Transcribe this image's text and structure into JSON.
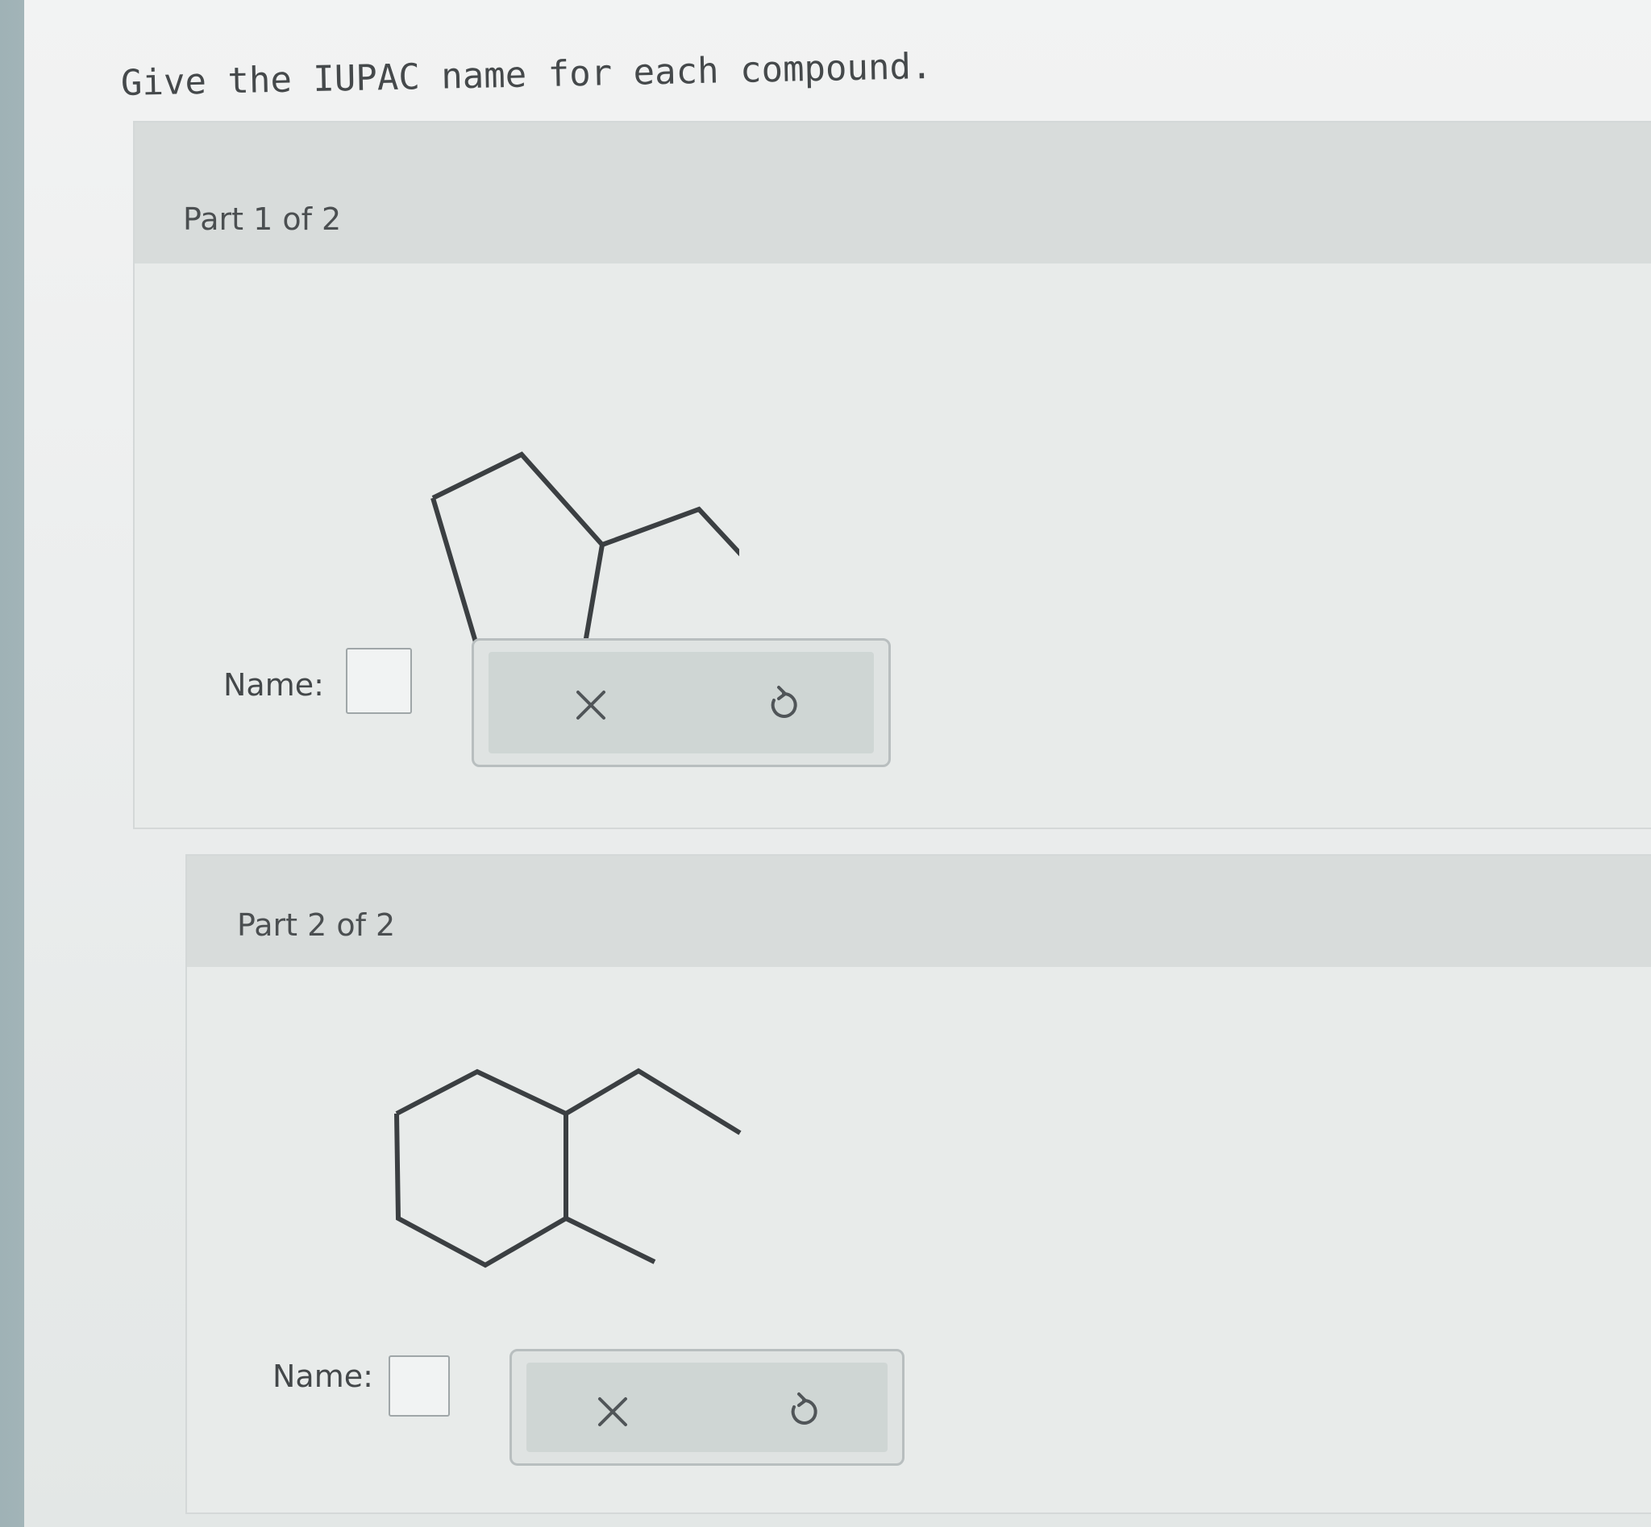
{
  "question": "Give the IUPAC name for each compound.",
  "parts": [
    {
      "title": "Part 1 of 2",
      "name_label": "Name:",
      "clear_icon": "x-icon",
      "reset_icon": "undo-icon"
    },
    {
      "title": "Part 2 of 2",
      "name_label": "Name:",
      "clear_icon": "x-icon",
      "reset_icon": "undo-icon"
    }
  ]
}
